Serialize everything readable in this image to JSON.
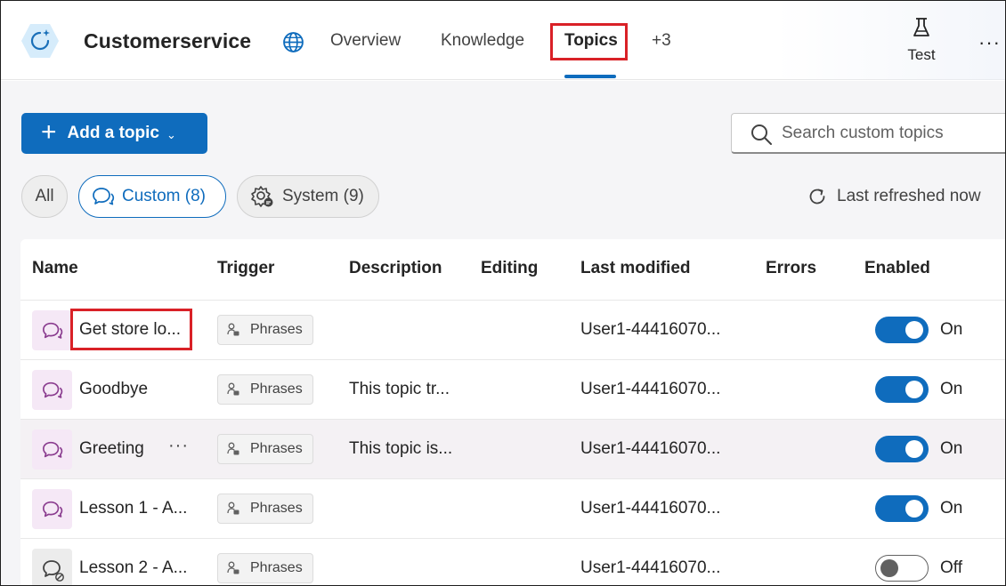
{
  "header": {
    "bot_name": "Customerservice",
    "tabs": [
      {
        "label": "Overview"
      },
      {
        "label": "Knowledge"
      },
      {
        "label": "Topics"
      },
      {
        "label": "+3"
      }
    ],
    "test_label": "Test",
    "more": "···"
  },
  "toolbar": {
    "add_topic_label": "Add a topic",
    "search_placeholder": "Search custom topics"
  },
  "filters": {
    "all": "All",
    "custom": "Custom (8)",
    "system": "System (9)",
    "last_refreshed": "Last refreshed now"
  },
  "table": {
    "columns": [
      "Name",
      "Trigger",
      "Description",
      "Editing",
      "Last modified",
      "Errors",
      "Enabled"
    ],
    "rows": [
      {
        "name": "Get store lo...",
        "trigger": "Phrases",
        "description": "",
        "modified": "User1-44416070...",
        "enabled": true,
        "state": "On"
      },
      {
        "name": "Goodbye",
        "trigger": "Phrases",
        "description": "This topic tr...",
        "modified": "User1-44416070...",
        "enabled": true,
        "state": "On"
      },
      {
        "name": "Greeting",
        "trigger": "Phrases",
        "description": "This topic is...",
        "modified": "User1-44416070...",
        "enabled": true,
        "state": "On"
      },
      {
        "name": "Lesson 1 - A...",
        "trigger": "Phrases",
        "description": "",
        "modified": "User1-44416070...",
        "enabled": true,
        "state": "On"
      },
      {
        "name": "Lesson 2 - A...",
        "trigger": "Phrases",
        "description": "",
        "modified": "User1-44416070...",
        "enabled": false,
        "state": "Off"
      }
    ]
  },
  "colors": {
    "accent": "#0f6cbd",
    "highlight": "#d92127",
    "topic_icon": "#8a3c8f"
  }
}
